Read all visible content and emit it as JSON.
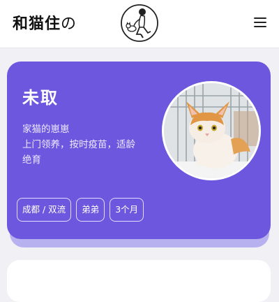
{
  "header": {
    "brand_main": "和猫住",
    "brand_suffix": "の",
    "logo_icon": "cat-person-logo-icon",
    "menu_icon": "hamburger-menu-icon"
  },
  "cat_card": {
    "name": "未取",
    "description_lines": [
      "家猫的崽崽",
      "上门领养，按时疫苗，适龄",
      "绝育"
    ],
    "photo_icon": "orange-white-kitten-photo",
    "tags": [
      "成都 / 双流",
      "弟弟",
      "3个月"
    ],
    "colors": {
      "card": "#6d57de",
      "card_shadow": "#b8b1f0",
      "background": "#f1f1f5"
    }
  }
}
